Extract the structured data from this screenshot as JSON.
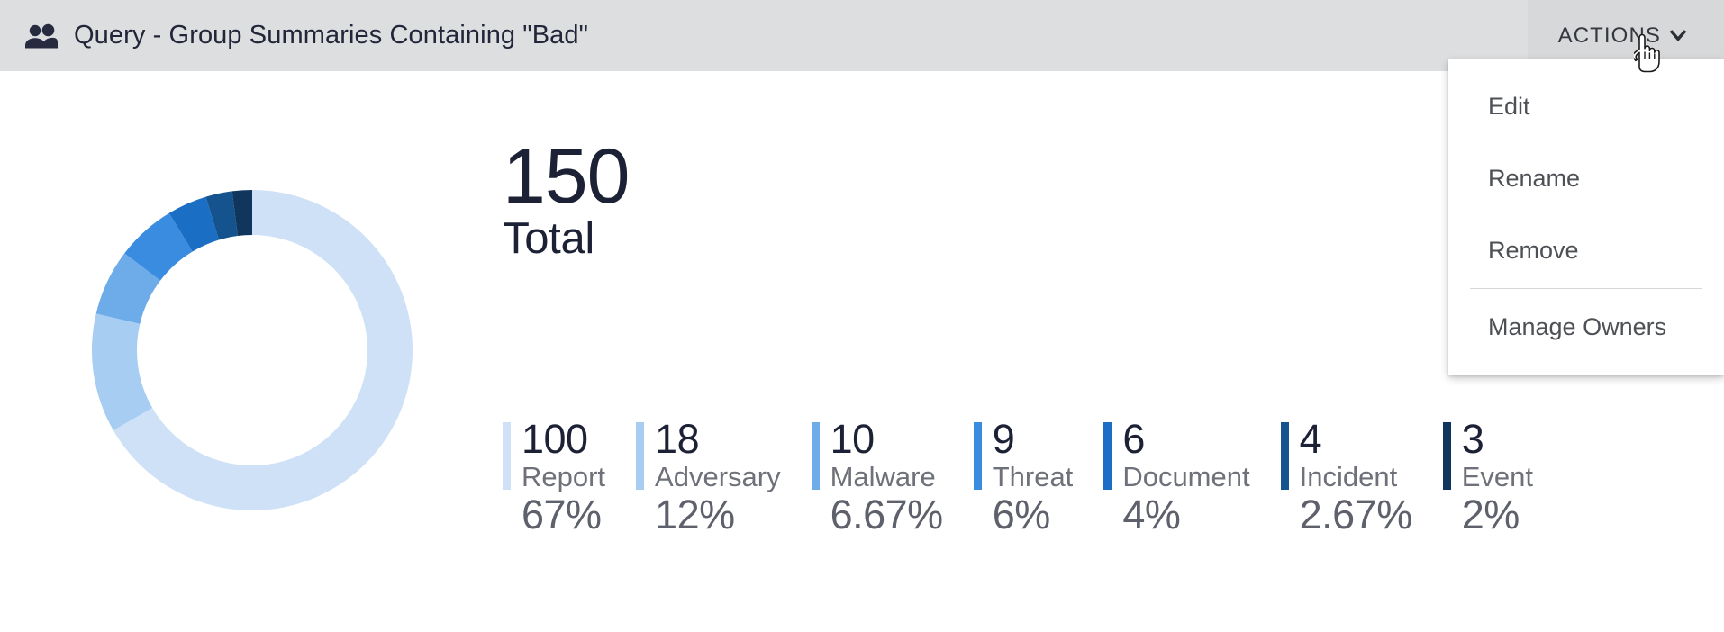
{
  "header": {
    "icon": "people-icon",
    "title": "Query - Group Summaries Containing \"Bad\"",
    "actions_label": "ACTIONS",
    "chevron_icon": "chevron-down-icon",
    "background_color": "#dcdee0"
  },
  "actions_menu": {
    "open": true,
    "items": [
      {
        "label": "Edit"
      },
      {
        "label": "Rename"
      },
      {
        "label": "Remove"
      },
      {
        "divider": true
      },
      {
        "label": "Manage Owners"
      }
    ]
  },
  "summary": {
    "total_value": "150",
    "total_label": "Total"
  },
  "chart_data": {
    "type": "pie",
    "title": "",
    "variant": "donut",
    "total": 150,
    "total_label": "Total",
    "start_angle_deg": 0,
    "direction": "clockwise",
    "legend": "inline-stats-below",
    "categories": [
      "Report",
      "Adversary",
      "Malware",
      "Threat",
      "Document",
      "Incident",
      "Event"
    ],
    "values": [
      100,
      18,
      10,
      9,
      6,
      4,
      3
    ],
    "percent_labels": [
      "67%",
      "12%",
      "6.67%",
      "6%",
      "4%",
      "2.67%",
      "2%"
    ],
    "percents": [
      66.67,
      12.0,
      6.67,
      6.0,
      4.0,
      2.67,
      2.0
    ],
    "colors": [
      "#cee1f6",
      "#a7cdf2",
      "#6eace9",
      "#3a8ce0",
      "#1a6ec4",
      "#15538f",
      "#11365e"
    ]
  },
  "stats": [
    {
      "count": "100",
      "label": "Report",
      "percent": "67%",
      "color": "#cee1f6"
    },
    {
      "count": "18",
      "label": "Adversary",
      "percent": "12%",
      "color": "#a7cdf2"
    },
    {
      "count": "10",
      "label": "Malware",
      "percent": "6.67%",
      "color": "#6eace9"
    },
    {
      "count": "9",
      "label": "Threat",
      "percent": "6%",
      "color": "#3a8ce0"
    },
    {
      "count": "6",
      "label": "Document",
      "percent": "4%",
      "color": "#1a6ec4"
    },
    {
      "count": "4",
      "label": "Incident",
      "percent": "2.67%",
      "color": "#15538f"
    },
    {
      "count": "3",
      "label": "Event",
      "percent": "2%",
      "color": "#11365e"
    }
  ]
}
